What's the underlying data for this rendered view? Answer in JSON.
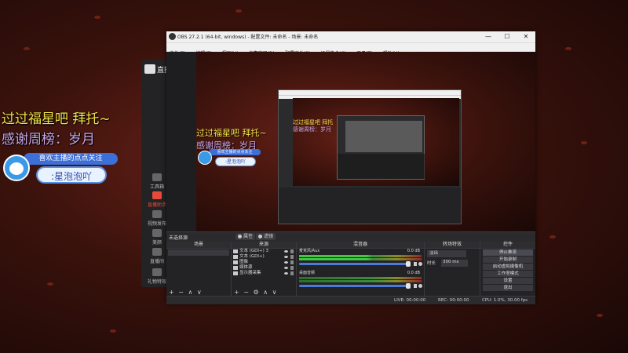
{
  "overlay": {
    "line1": "过过福星吧  拜托~",
    "line2": "感谢周榜：岁月",
    "follow_prompt": "喜欢主播的点点关注",
    "follow_id": ":星泡泡吖"
  },
  "bg_app": {
    "logo_text": "直播",
    "nav": [
      "工具箱",
      "直播助手",
      "视频发布",
      "美颜",
      "直播间",
      "礼物特效"
    ]
  },
  "obs": {
    "title": "OBS 27.2.1 (64-bit, windows) - 配置文件: 未命名 - 场景: 未命名",
    "window_buttons": [
      "—",
      "☐",
      "✕"
    ],
    "menu": [
      "文件(F)",
      "编辑(E)",
      "视图(V)",
      "停靠窗口(D)",
      "配置文件(P)",
      "场景集合(S)",
      "工具(T)",
      "帮助(H)"
    ],
    "preview_text1": "过过福星吧  拜托~",
    "preview_text2": "感谢周榜：岁月",
    "preview_card_top": "喜欢主播的点点关注",
    "preview_card_id": ":星泡泡吖",
    "nested_text1": "过过福星吧 拜托",
    "nested_text2": "感谢周榜：岁月",
    "no_source_label": "未选择源",
    "properties_btn": "属性",
    "filters_btn": "滤镜",
    "docks": {
      "scenes_header": "场景",
      "sources_header": "来源",
      "mixer_header": "混音器",
      "transitions_header": "转场特效",
      "controls_header": "控件"
    },
    "sources": [
      {
        "name": "文本 (GDI+) 3",
        "icon": "text-icon"
      },
      {
        "name": "文本 (GDI+)",
        "icon": "text-icon"
      },
      {
        "name": "图像",
        "icon": "image-icon"
      },
      {
        "name": "媒体源",
        "icon": "media-icon"
      },
      {
        "name": "显示器采集",
        "icon": "monitor-icon"
      }
    ],
    "mixer": [
      {
        "name": "桌面音频",
        "db": "0.0 dB"
      },
      {
        "name": "麦克风/Aux",
        "db": "0.0 dB"
      }
    ],
    "transition": {
      "type": "淡出",
      "duration_label": "时长",
      "duration_value": "300 ms"
    },
    "controls": [
      "停止推流",
      "开始录制",
      "启动虚拟摄像机",
      "工作室模式",
      "设置",
      "退出"
    ],
    "footer_icons": [
      "+",
      "−",
      "⚙",
      "∧",
      "∨"
    ],
    "status": {
      "live": "LIVE: 00:00:00",
      "rec": "REC: 00:00:00",
      "cpu": "CPU: 1.0%, 30.00 fps",
      "dropped": "kb/s: 0"
    }
  }
}
